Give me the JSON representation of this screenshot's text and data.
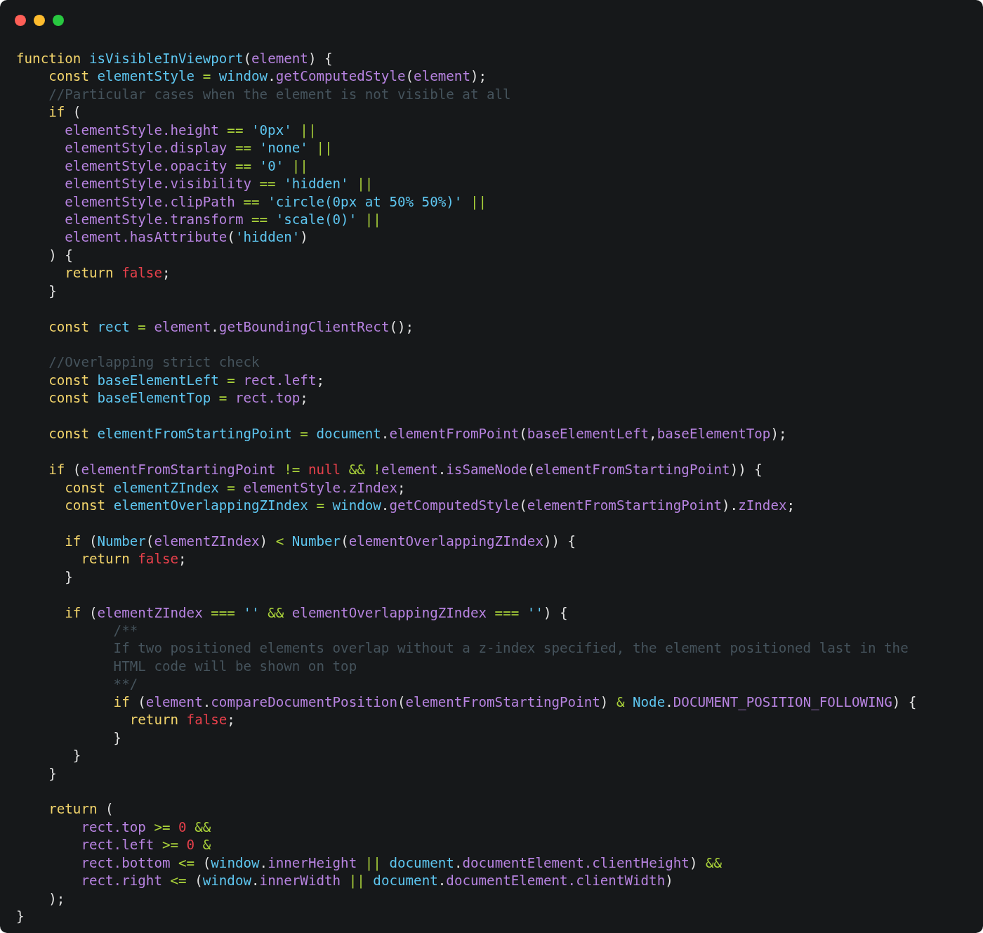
{
  "window": {
    "controls": [
      {
        "kind": "close"
      },
      {
        "kind": "minimize"
      },
      {
        "kind": "maximize"
      }
    ]
  },
  "code": {
    "lines": [
      {
        "kind": "code",
        "tokens": [
          {
            "kind": "keyword",
            "text": "function "
          },
          {
            "kind": "name",
            "text": "isVisibleInViewport"
          },
          {
            "kind": "plain",
            "text": "("
          },
          {
            "kind": "prop",
            "text": "element"
          },
          {
            "kind": "plain",
            "text": ") {"
          }
        ]
      },
      {
        "kind": "code",
        "tokens": [
          {
            "kind": "keyword",
            "text": "    const "
          },
          {
            "kind": "name",
            "text": "elementStyle"
          },
          {
            "kind": "op",
            "text": " = "
          },
          {
            "kind": "name",
            "text": "window"
          },
          {
            "kind": "plain",
            "text": "."
          },
          {
            "kind": "prop",
            "text": "getComputedStyle"
          },
          {
            "kind": "plain",
            "text": "("
          },
          {
            "kind": "prop",
            "text": "element"
          },
          {
            "kind": "plain",
            "text": ");"
          }
        ]
      },
      {
        "kind": "code",
        "tokens": [
          {
            "kind": "comment",
            "text": "    //Particular cases when the element is not visible at all"
          }
        ]
      },
      {
        "kind": "code",
        "tokens": [
          {
            "kind": "keyword",
            "text": "    if"
          },
          {
            "kind": "plain",
            "text": " ("
          }
        ]
      },
      {
        "kind": "code",
        "tokens": [
          {
            "kind": "prop",
            "text": "      elementStyle.height"
          },
          {
            "kind": "op",
            "text": " == "
          },
          {
            "kind": "string",
            "text": "'0px'"
          },
          {
            "kind": "op",
            "text": " ||"
          }
        ]
      },
      {
        "kind": "code",
        "tokens": [
          {
            "kind": "prop",
            "text": "      elementStyle.display"
          },
          {
            "kind": "op",
            "text": " == "
          },
          {
            "kind": "string",
            "text": "'none'"
          },
          {
            "kind": "op",
            "text": " ||"
          }
        ]
      },
      {
        "kind": "code",
        "tokens": [
          {
            "kind": "prop",
            "text": "      elementStyle.opacity"
          },
          {
            "kind": "op",
            "text": " == "
          },
          {
            "kind": "string",
            "text": "'0'"
          },
          {
            "kind": "op",
            "text": " ||"
          }
        ]
      },
      {
        "kind": "code",
        "tokens": [
          {
            "kind": "prop",
            "text": "      elementStyle.visibility"
          },
          {
            "kind": "op",
            "text": " == "
          },
          {
            "kind": "string",
            "text": "'hidden'"
          },
          {
            "kind": "op",
            "text": " ||"
          }
        ]
      },
      {
        "kind": "code",
        "tokens": [
          {
            "kind": "prop",
            "text": "      elementStyle.clipPath"
          },
          {
            "kind": "op",
            "text": " == "
          },
          {
            "kind": "string",
            "text": "'circle(0px at 50% 50%)'"
          },
          {
            "kind": "op",
            "text": " ||"
          }
        ]
      },
      {
        "kind": "code",
        "tokens": [
          {
            "kind": "prop",
            "text": "      elementStyle.transform"
          },
          {
            "kind": "op",
            "text": " == "
          },
          {
            "kind": "string",
            "text": "'scale(0)'"
          },
          {
            "kind": "op",
            "text": " ||"
          }
        ]
      },
      {
        "kind": "code",
        "tokens": [
          {
            "kind": "prop",
            "text": "      element.hasAttribute"
          },
          {
            "kind": "plain",
            "text": "("
          },
          {
            "kind": "string",
            "text": "'hidden'"
          },
          {
            "kind": "plain",
            "text": ")"
          }
        ]
      },
      {
        "kind": "code",
        "tokens": [
          {
            "kind": "plain",
            "text": "    ) {"
          }
        ]
      },
      {
        "kind": "code",
        "tokens": [
          {
            "kind": "keyword",
            "text": "      return "
          },
          {
            "kind": "literal",
            "text": "false"
          },
          {
            "kind": "plain",
            "text": ";"
          }
        ]
      },
      {
        "kind": "code",
        "tokens": [
          {
            "kind": "plain",
            "text": "    }"
          }
        ]
      },
      {
        "kind": "blank"
      },
      {
        "kind": "code",
        "tokens": [
          {
            "kind": "keyword",
            "text": "    const "
          },
          {
            "kind": "name",
            "text": "rect"
          },
          {
            "kind": "op",
            "text": " = "
          },
          {
            "kind": "prop",
            "text": "element"
          },
          {
            "kind": "plain",
            "text": "."
          },
          {
            "kind": "prop",
            "text": "getBoundingClientRect"
          },
          {
            "kind": "plain",
            "text": "();"
          }
        ]
      },
      {
        "kind": "blank"
      },
      {
        "kind": "code",
        "tokens": [
          {
            "kind": "comment",
            "text": "    //Overlapping strict check"
          }
        ]
      },
      {
        "kind": "code",
        "tokens": [
          {
            "kind": "keyword",
            "text": "    const "
          },
          {
            "kind": "name",
            "text": "baseElementLeft"
          },
          {
            "kind": "op",
            "text": " = "
          },
          {
            "kind": "prop",
            "text": "rect.left"
          },
          {
            "kind": "plain",
            "text": ";"
          }
        ]
      },
      {
        "kind": "code",
        "tokens": [
          {
            "kind": "keyword",
            "text": "    const "
          },
          {
            "kind": "name",
            "text": "baseElementTop"
          },
          {
            "kind": "op",
            "text": " = "
          },
          {
            "kind": "prop",
            "text": "rect.top"
          },
          {
            "kind": "plain",
            "text": ";"
          }
        ]
      },
      {
        "kind": "blank"
      },
      {
        "kind": "code",
        "tokens": [
          {
            "kind": "keyword",
            "text": "    const "
          },
          {
            "kind": "name",
            "text": "elementFromStartingPoint"
          },
          {
            "kind": "op",
            "text": " = "
          },
          {
            "kind": "name",
            "text": "document"
          },
          {
            "kind": "plain",
            "text": "."
          },
          {
            "kind": "prop",
            "text": "elementFromPoint"
          },
          {
            "kind": "plain",
            "text": "("
          },
          {
            "kind": "prop",
            "text": "baseElementLeft"
          },
          {
            "kind": "plain",
            "text": ","
          },
          {
            "kind": "prop",
            "text": "baseElementTop"
          },
          {
            "kind": "plain",
            "text": ");"
          }
        ]
      },
      {
        "kind": "blank"
      },
      {
        "kind": "code",
        "tokens": [
          {
            "kind": "keyword",
            "text": "    if"
          },
          {
            "kind": "plain",
            "text": " ("
          },
          {
            "kind": "prop",
            "text": "elementFromStartingPoint"
          },
          {
            "kind": "op",
            "text": " != "
          },
          {
            "kind": "literal",
            "text": "null"
          },
          {
            "kind": "op",
            "text": " && !"
          },
          {
            "kind": "prop",
            "text": "element"
          },
          {
            "kind": "plain",
            "text": "."
          },
          {
            "kind": "prop",
            "text": "isSameNode"
          },
          {
            "kind": "plain",
            "text": "("
          },
          {
            "kind": "prop",
            "text": "elementFromStartingPoint"
          },
          {
            "kind": "plain",
            "text": ")) {"
          }
        ]
      },
      {
        "kind": "code",
        "tokens": [
          {
            "kind": "keyword",
            "text": "      const "
          },
          {
            "kind": "name",
            "text": "elementZIndex"
          },
          {
            "kind": "op",
            "text": " = "
          },
          {
            "kind": "prop",
            "text": "elementStyle.zIndex"
          },
          {
            "kind": "plain",
            "text": ";"
          }
        ]
      },
      {
        "kind": "code",
        "tokens": [
          {
            "kind": "keyword",
            "text": "      const "
          },
          {
            "kind": "name",
            "text": "elementOverlappingZIndex"
          },
          {
            "kind": "op",
            "text": " = "
          },
          {
            "kind": "name",
            "text": "window"
          },
          {
            "kind": "plain",
            "text": "."
          },
          {
            "kind": "prop",
            "text": "getComputedStyle"
          },
          {
            "kind": "plain",
            "text": "("
          },
          {
            "kind": "prop",
            "text": "elementFromStartingPoint"
          },
          {
            "kind": "plain",
            "text": ")."
          },
          {
            "kind": "prop",
            "text": "zIndex"
          },
          {
            "kind": "plain",
            "text": ";"
          }
        ]
      },
      {
        "kind": "blank"
      },
      {
        "kind": "code",
        "tokens": [
          {
            "kind": "keyword",
            "text": "      if"
          },
          {
            "kind": "plain",
            "text": " ("
          },
          {
            "kind": "name",
            "text": "Number"
          },
          {
            "kind": "plain",
            "text": "("
          },
          {
            "kind": "prop",
            "text": "elementZIndex"
          },
          {
            "kind": "plain",
            "text": ")"
          },
          {
            "kind": "op",
            "text": " < "
          },
          {
            "kind": "name",
            "text": "Number"
          },
          {
            "kind": "plain",
            "text": "("
          },
          {
            "kind": "prop",
            "text": "elementOverlappingZIndex"
          },
          {
            "kind": "plain",
            "text": ")) {"
          }
        ]
      },
      {
        "kind": "code",
        "tokens": [
          {
            "kind": "keyword",
            "text": "        return "
          },
          {
            "kind": "literal",
            "text": "false"
          },
          {
            "kind": "plain",
            "text": ";"
          }
        ]
      },
      {
        "kind": "code",
        "tokens": [
          {
            "kind": "plain",
            "text": "      }"
          }
        ]
      },
      {
        "kind": "blank"
      },
      {
        "kind": "code",
        "tokens": [
          {
            "kind": "keyword",
            "text": "      if"
          },
          {
            "kind": "plain",
            "text": " ("
          },
          {
            "kind": "prop",
            "text": "elementZIndex"
          },
          {
            "kind": "op",
            "text": " === "
          },
          {
            "kind": "string",
            "text": "''"
          },
          {
            "kind": "op",
            "text": " && "
          },
          {
            "kind": "prop",
            "text": "elementOverlappingZIndex"
          },
          {
            "kind": "op",
            "text": " === "
          },
          {
            "kind": "string",
            "text": "''"
          },
          {
            "kind": "plain",
            "text": ") {"
          }
        ]
      },
      {
        "kind": "code",
        "tokens": [
          {
            "kind": "comment",
            "text": "            /**"
          }
        ]
      },
      {
        "kind": "code",
        "tokens": [
          {
            "kind": "comment",
            "text": "            If two positioned elements overlap without a z-index specified, the element positioned last in the"
          }
        ]
      },
      {
        "kind": "code",
        "tokens": [
          {
            "kind": "comment",
            "text": "            HTML code will be shown on top"
          }
        ]
      },
      {
        "kind": "code",
        "tokens": [
          {
            "kind": "comment",
            "text": "            **/"
          }
        ]
      },
      {
        "kind": "code",
        "tokens": [
          {
            "kind": "keyword",
            "text": "            if"
          },
          {
            "kind": "plain",
            "text": " ("
          },
          {
            "kind": "prop",
            "text": "element"
          },
          {
            "kind": "plain",
            "text": "."
          },
          {
            "kind": "prop",
            "text": "compareDocumentPosition"
          },
          {
            "kind": "plain",
            "text": "("
          },
          {
            "kind": "prop",
            "text": "elementFromStartingPoint"
          },
          {
            "kind": "plain",
            "text": ")"
          },
          {
            "kind": "op",
            "text": " & "
          },
          {
            "kind": "name",
            "text": "Node"
          },
          {
            "kind": "plain",
            "text": "."
          },
          {
            "kind": "prop",
            "text": "DOCUMENT_POSITION_FOLLOWING"
          },
          {
            "kind": "plain",
            "text": ") {"
          }
        ]
      },
      {
        "kind": "code",
        "tokens": [
          {
            "kind": "keyword",
            "text": "              return "
          },
          {
            "kind": "literal",
            "text": "false"
          },
          {
            "kind": "plain",
            "text": ";"
          }
        ]
      },
      {
        "kind": "code",
        "tokens": [
          {
            "kind": "plain",
            "text": "            }"
          }
        ]
      },
      {
        "kind": "code",
        "tokens": [
          {
            "kind": "plain",
            "text": "       }"
          }
        ]
      },
      {
        "kind": "code",
        "tokens": [
          {
            "kind": "plain",
            "text": "    }"
          }
        ]
      },
      {
        "kind": "blank"
      },
      {
        "kind": "code",
        "tokens": [
          {
            "kind": "keyword",
            "text": "    return"
          },
          {
            "kind": "plain",
            "text": " ("
          }
        ]
      },
      {
        "kind": "code",
        "tokens": [
          {
            "kind": "prop",
            "text": "        rect.top"
          },
          {
            "kind": "op",
            "text": " >= "
          },
          {
            "kind": "literal",
            "text": "0"
          },
          {
            "kind": "op",
            "text": " &&"
          }
        ]
      },
      {
        "kind": "code",
        "tokens": [
          {
            "kind": "prop",
            "text": "        rect.left"
          },
          {
            "kind": "op",
            "text": " >= "
          },
          {
            "kind": "literal",
            "text": "0"
          },
          {
            "kind": "op",
            "text": " &"
          }
        ]
      },
      {
        "kind": "code",
        "tokens": [
          {
            "kind": "prop",
            "text": "        rect.bottom"
          },
          {
            "kind": "op",
            "text": " <= "
          },
          {
            "kind": "plain",
            "text": "("
          },
          {
            "kind": "name",
            "text": "window"
          },
          {
            "kind": "plain",
            "text": "."
          },
          {
            "kind": "prop",
            "text": "innerHeight"
          },
          {
            "kind": "op",
            "text": " || "
          },
          {
            "kind": "name",
            "text": "document"
          },
          {
            "kind": "plain",
            "text": "."
          },
          {
            "kind": "prop",
            "text": "documentElement.clientHeight"
          },
          {
            "kind": "plain",
            "text": ")"
          },
          {
            "kind": "op",
            "text": " &&"
          }
        ]
      },
      {
        "kind": "code",
        "tokens": [
          {
            "kind": "prop",
            "text": "        rect.right"
          },
          {
            "kind": "op",
            "text": " <= "
          },
          {
            "kind": "plain",
            "text": "("
          },
          {
            "kind": "name",
            "text": "window"
          },
          {
            "kind": "plain",
            "text": "."
          },
          {
            "kind": "prop",
            "text": "innerWidth"
          },
          {
            "kind": "op",
            "text": " || "
          },
          {
            "kind": "name",
            "text": "document"
          },
          {
            "kind": "plain",
            "text": "."
          },
          {
            "kind": "prop",
            "text": "documentElement.clientWidth"
          },
          {
            "kind": "plain",
            "text": ")"
          }
        ]
      },
      {
        "kind": "code",
        "tokens": [
          {
            "kind": "plain",
            "text": "    );"
          }
        ]
      },
      {
        "kind": "code",
        "tokens": [
          {
            "kind": "plain",
            "text": "}"
          }
        ]
      }
    ]
  }
}
